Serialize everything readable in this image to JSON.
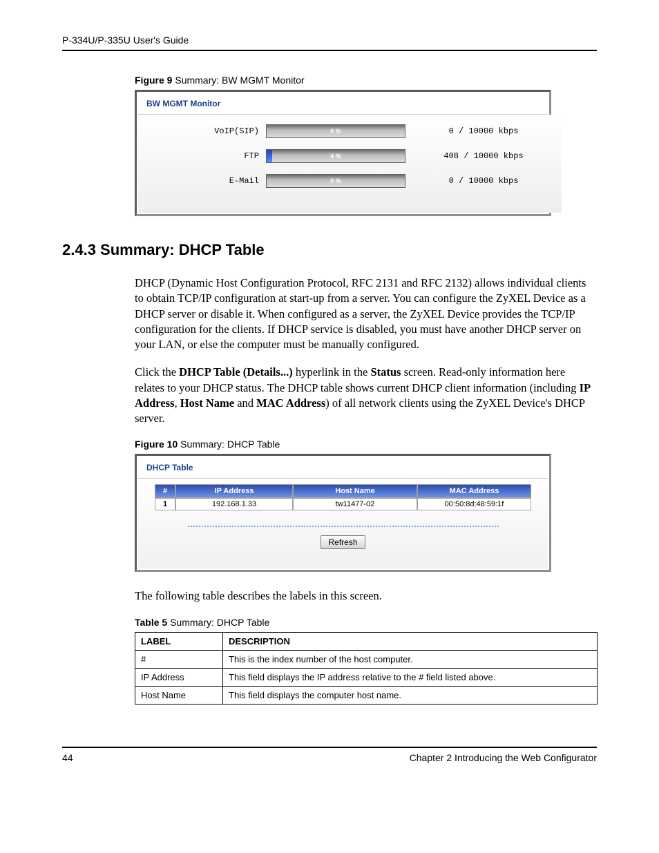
{
  "header": {
    "title": "P-334U/P-335U User's Guide"
  },
  "figure9": {
    "caption_bold": "Figure 9",
    "caption_rest": "   Summary: BW MGMT Monitor",
    "panel_title": "BW MGMT Monitor",
    "rows": [
      {
        "label": "VoIP(SIP)",
        "pct_text": "0 %",
        "pct_val": 0,
        "value_text": "0 / 10000 kbps"
      },
      {
        "label": "FTP",
        "pct_text": "4 %",
        "pct_val": 4,
        "value_text": "408 / 10000 kbps"
      },
      {
        "label": "E-Mail",
        "pct_text": "0 %",
        "pct_val": 0,
        "value_text": "0 / 10000 kbps"
      }
    ]
  },
  "section": {
    "heading": "2.4.3  Summary: DHCP Table",
    "para1_text_1": "DHCP (Dynamic Host Configuration Protocol, RFC 2131 and RFC 2132) allows individual clients to obtain TCP/IP configuration at start-up from a server. You can configure the ZyXEL Device as a DHCP server or disable it. When configured as a server, the ZyXEL Device provides the TCP/IP configuration for the clients. If DHCP service is disabled, you must have another DHCP server on your LAN, or else the computer must be manually configured.",
    "para2_pre": "Click the ",
    "para2_b1": "DHCP Table (Details...)",
    "para2_mid1": " hyperlink in the ",
    "para2_b2": "Status",
    "para2_mid2": " screen. Read-only information here relates to your DHCP status. The DHCP table shows current DHCP client information (including ",
    "para2_b3": "IP Address",
    "para2_mid3": ", ",
    "para2_b4": "Host Name",
    "para2_mid4": " and ",
    "para2_b5": "MAC Address",
    "para2_mid5": ") of all network clients using the ZyXEL Device's DHCP server.",
    "para3": "The following table describes the labels in this screen."
  },
  "figure10": {
    "caption_bold": "Figure 10",
    "caption_rest": "   Summary: DHCP Table",
    "panel_title": "DHCP Table",
    "headers": {
      "num": "#",
      "ip": "IP Address",
      "host": "Host Name",
      "mac": "MAC Address"
    },
    "row": {
      "num": "1",
      "ip": "192.168.1.33",
      "host": "tw11477-02",
      "mac": "00:50:8d:48:59:1f"
    },
    "refresh_label": "Refresh"
  },
  "table5": {
    "caption_bold": "Table 5",
    "caption_rest": "   Summary: DHCP Table",
    "head_label": "LABEL",
    "head_desc": "DESCRIPTION",
    "rows": [
      {
        "label": "#",
        "desc": "This is the index number of the host computer."
      },
      {
        "label": "IP Address",
        "desc": "This field displays the IP address relative to the # field listed above."
      },
      {
        "label": "Host Name",
        "desc": "This field displays the computer host name."
      }
    ]
  },
  "footer": {
    "page_number": "44",
    "chapter": "Chapter 2 Introducing the Web Configurator"
  }
}
